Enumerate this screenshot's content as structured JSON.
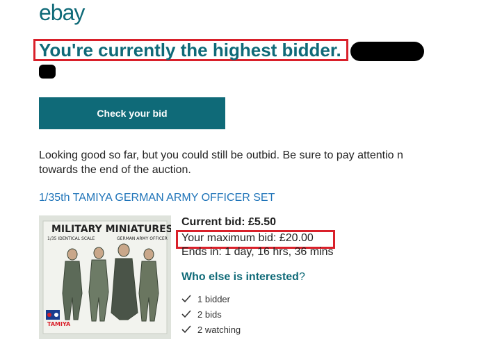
{
  "logo": {
    "text": "ebay",
    "color": "#0f6a78"
  },
  "headline": {
    "text": "You're currently the highest bidder."
  },
  "cta": {
    "label": "Check your bid"
  },
  "message": {
    "text": "Looking good so far, but you could still be outbid. Be sure to pay attentio n towards the end of the auction."
  },
  "item": {
    "title": "1/35th TAMIYA GERMAN ARMY OFFICER SET",
    "image": {
      "box_title": "MILITARY MINIATURES",
      "sub_left": "1/35 IDENTICAL SCALE",
      "sub_right": "GERMAN ARMY OFFICER",
      "brand": "TAMIYA"
    }
  },
  "bid": {
    "current": "Current bid: £5.50",
    "maximum": "Your maximum bid: £20.00",
    "ends": "Ends in: 1 day, 16 hrs, 36 mins"
  },
  "interest": {
    "heading_bold": "Who else is interested",
    "heading_suffix": "?",
    "stats": [
      "1 bidder",
      "2 bids",
      "2 watching"
    ]
  },
  "colors": {
    "accent": "#0f6a78",
    "link": "#1f74b9",
    "highlight_border": "#d9202a"
  }
}
